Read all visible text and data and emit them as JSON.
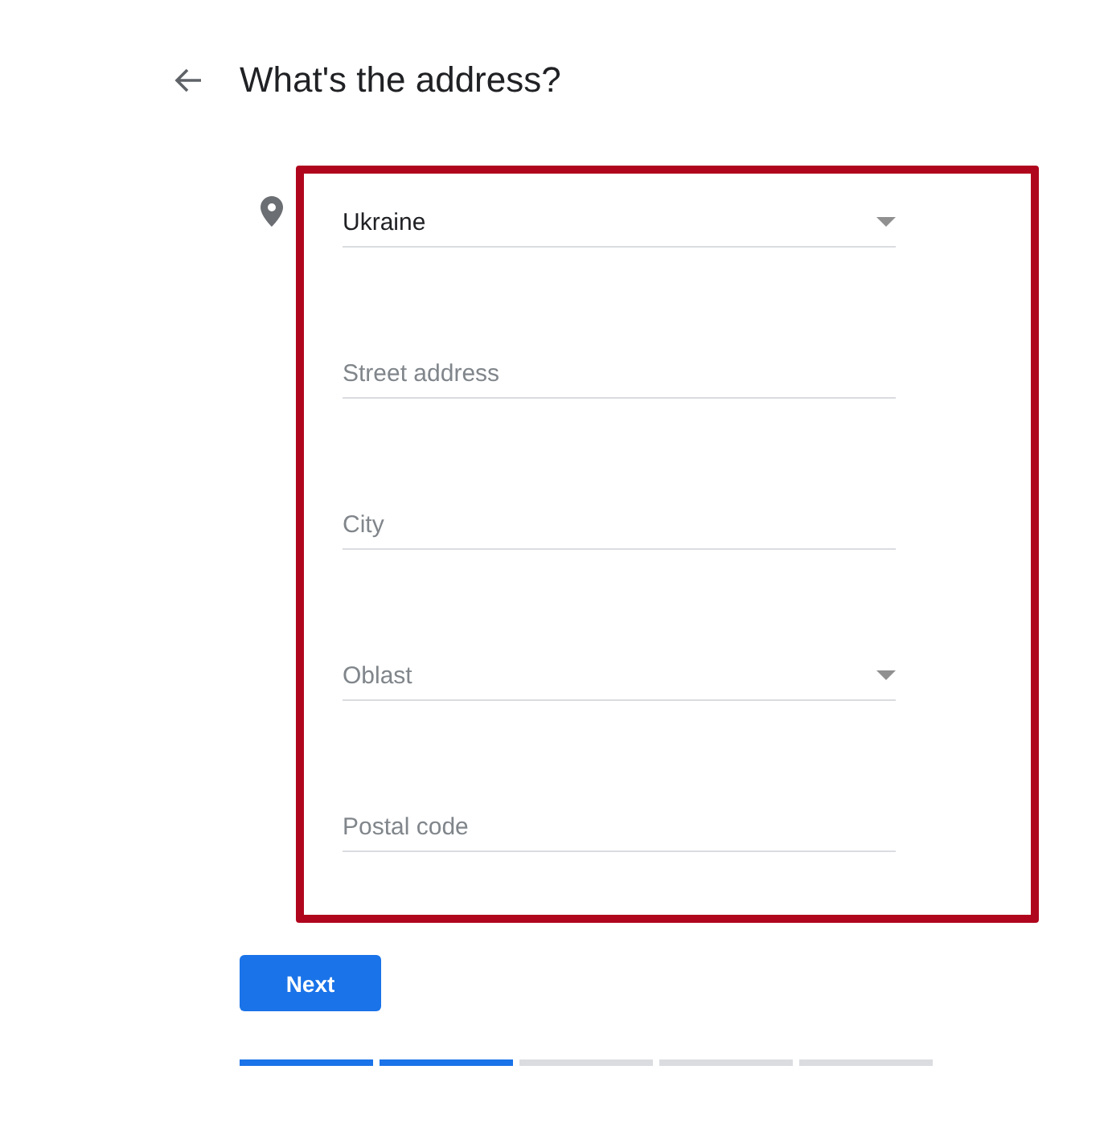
{
  "header": {
    "title": "What's the address?"
  },
  "fields": [
    {
      "kind": "select",
      "value": "Ukraine"
    },
    {
      "kind": "text",
      "placeholder": "Street address"
    },
    {
      "kind": "text",
      "placeholder": "City"
    },
    {
      "kind": "select",
      "placeholder": "Oblast"
    },
    {
      "kind": "text",
      "placeholder": "Postal code"
    }
  ],
  "next_button": {
    "label": "Next"
  },
  "progress": [
    {
      "complete": true
    },
    {
      "complete": true
    },
    {
      "complete": false
    },
    {
      "complete": false
    },
    {
      "complete": false
    }
  ]
}
